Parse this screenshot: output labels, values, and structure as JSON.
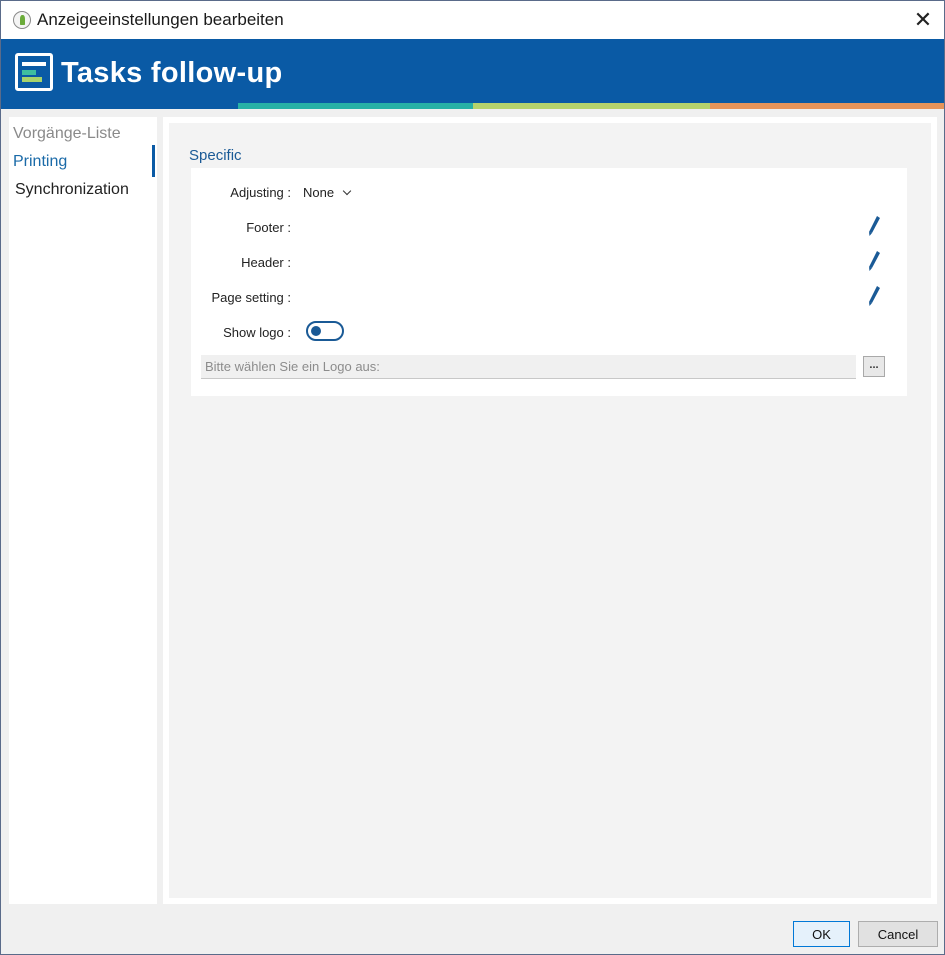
{
  "window": {
    "title": "Anzeigeeinstellungen bearbeiten",
    "close_glyph": "✕"
  },
  "banner": {
    "title": "Tasks follow-up",
    "icon": "list-window-icon"
  },
  "nav": {
    "items": [
      {
        "label": "Vorgänge-Liste",
        "state": "dim"
      },
      {
        "label": "Printing",
        "state": "active"
      },
      {
        "label": "Synchronization",
        "state": "normal"
      }
    ]
  },
  "section": {
    "title": "Specific"
  },
  "form": {
    "adjusting_label": "Adjusting :",
    "adjusting_value": "None",
    "footer_label": "Footer :",
    "header_label": "Header :",
    "page_setting_label": "Page setting :",
    "show_logo_label": "Show logo :",
    "show_logo_state": "off",
    "logo_placeholder": "Bitte wählen Sie ein Logo aus:",
    "browse_label": "..."
  },
  "buttons": {
    "ok": "OK",
    "cancel": "Cancel"
  },
  "colors": {
    "banner": "#0a5aa5",
    "accent_teal": "#27b1a6",
    "accent_green": "#b5d36c",
    "accent_orange": "#e6945a",
    "link_blue": "#1a6aa8"
  }
}
